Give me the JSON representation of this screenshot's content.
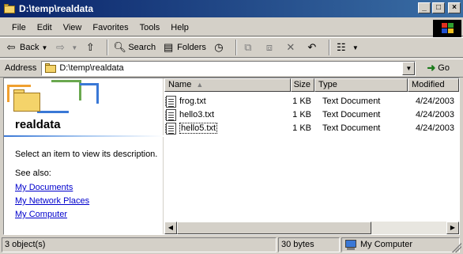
{
  "window": {
    "title": "D:\\temp\\realdata",
    "controls": {
      "minimize": "_",
      "maximize": "□",
      "close": "×"
    }
  },
  "menu": [
    "File",
    "Edit",
    "View",
    "Favorites",
    "Tools",
    "Help"
  ],
  "toolbar": {
    "back_label": "Back",
    "search_label": "Search",
    "folders_label": "Folders"
  },
  "address": {
    "label": "Address",
    "value": "D:\\temp\\realdata",
    "go_label": "Go"
  },
  "left_pane": {
    "folder_name": "realdata",
    "description": "Select an item to view its description.",
    "see_also_label": "See also:",
    "links": [
      "My Documents",
      "My Network Places",
      "My Computer"
    ]
  },
  "file_list": {
    "columns": [
      "Name",
      "Size",
      "Type",
      "Modified"
    ],
    "rows": [
      {
        "name": "frog.txt",
        "size": "1 KB",
        "type": "Text Document",
        "modified": "4/24/2003"
      },
      {
        "name": "hello3.txt",
        "size": "1 KB",
        "type": "Text Document",
        "modified": "4/24/2003"
      },
      {
        "name": "hello5.txt",
        "size": "1 KB",
        "type": "Text Document",
        "modified": "4/24/2003"
      }
    ]
  },
  "status": {
    "objects": "3 object(s)",
    "size": "30 bytes",
    "location": "My Computer"
  },
  "colors": {
    "titlebar_start": "#0a246a",
    "titlebar_end": "#3a6ea5",
    "link": "#0000cc"
  }
}
